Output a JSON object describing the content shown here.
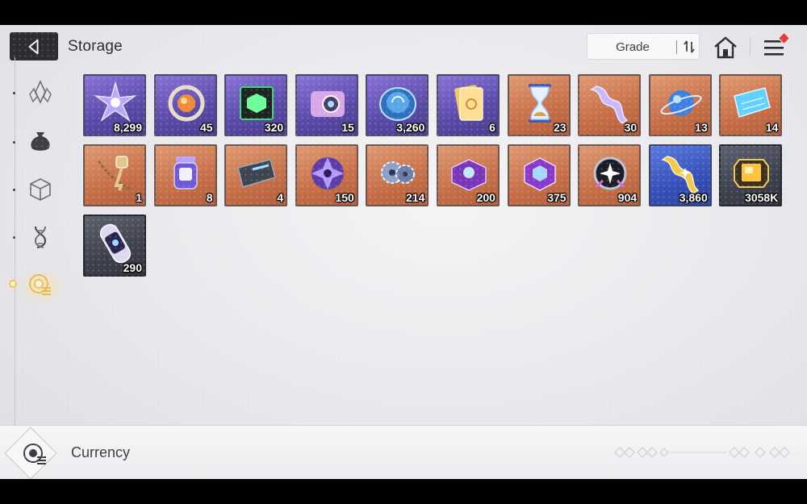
{
  "header": {
    "title": "Storage",
    "sort_label": "Grade"
  },
  "sidebar": {
    "items": [
      {
        "icon": "crystal-icon",
        "active": false
      },
      {
        "icon": "pouch-icon",
        "active": false
      },
      {
        "icon": "cube-icon",
        "active": false
      },
      {
        "icon": "dna-icon",
        "active": false
      },
      {
        "icon": "currency-icon",
        "active": true
      }
    ]
  },
  "items": [
    {
      "name": "star-shard-icon",
      "qty": "8,299",
      "grade": "purple"
    },
    {
      "name": "orb-ring-icon",
      "qty": "45",
      "grade": "purple"
    },
    {
      "name": "green-cube-icon",
      "qty": "320",
      "grade": "purple"
    },
    {
      "name": "camera-icon",
      "qty": "15",
      "grade": "purple"
    },
    {
      "name": "blue-coin-icon",
      "qty": "3,260",
      "grade": "purple"
    },
    {
      "name": "ticket-cards-icon",
      "qty": "6",
      "grade": "purple"
    },
    {
      "name": "hourglass-icon",
      "qty": "23",
      "grade": "orange"
    },
    {
      "name": "ribbon-icon",
      "qty": "30",
      "grade": "orange"
    },
    {
      "name": "planet-orb-icon",
      "qty": "13",
      "grade": "orange"
    },
    {
      "name": "blueprint-icon",
      "qty": "14",
      "grade": "orange"
    },
    {
      "name": "key-chain-icon",
      "qty": "1",
      "grade": "orange"
    },
    {
      "name": "canister-icon",
      "qty": "8",
      "grade": "orange"
    },
    {
      "name": "metal-plate-icon",
      "qty": "4",
      "grade": "orange"
    },
    {
      "name": "purple-core-icon",
      "qty": "150",
      "grade": "orange"
    },
    {
      "name": "gears-icon",
      "qty": "214",
      "grade": "orange"
    },
    {
      "name": "purple-chest-icon",
      "qty": "200",
      "grade": "orange"
    },
    {
      "name": "purple-box-icon",
      "qty": "375",
      "grade": "orange"
    },
    {
      "name": "dark-star-medal-icon",
      "qty": "904",
      "grade": "orange"
    },
    {
      "name": "gold-ribbon-icon",
      "qty": "3,860",
      "grade": "blue"
    },
    {
      "name": "gold-gem-icon",
      "qty": "3058K",
      "grade": "gray"
    },
    {
      "name": "capsule-icon",
      "qty": "290",
      "grade": "gray"
    }
  ],
  "footer": {
    "category_label": "Currency"
  },
  "colors": {
    "purple": "#6a58c0",
    "orange": "#c97650",
    "blue": "#3a58c4",
    "gray": "#454852",
    "accent_glow": "#f2c55a",
    "notify": "#e23c3c"
  }
}
